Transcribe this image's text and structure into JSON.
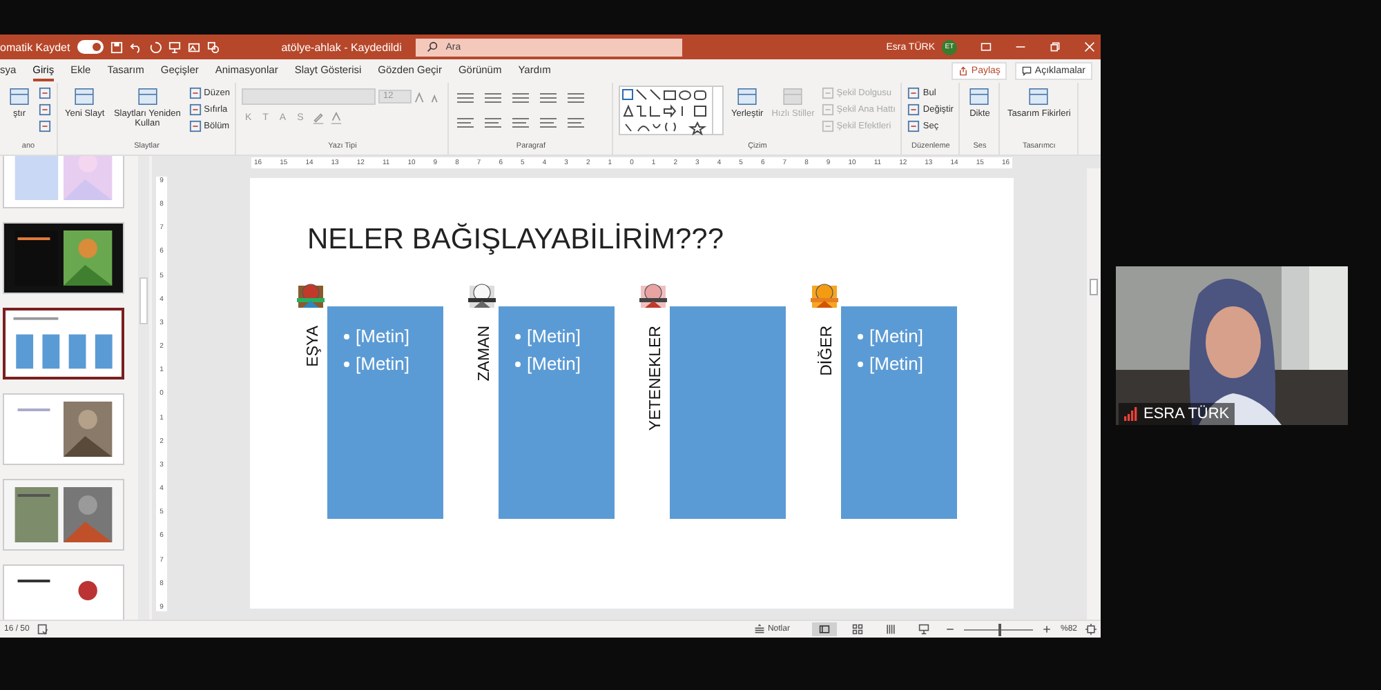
{
  "title_bar": {
    "autosave_label": "omatik Kaydet",
    "autosave_on": true,
    "doc_title": "atölye-ahlak  -  Kaydedildi",
    "search_placeholder": "Ara",
    "user_name": "Esra TÜRK",
    "user_initials": "ET"
  },
  "tabs": [
    {
      "label": "sya",
      "selected": false
    },
    {
      "label": "Giriş",
      "selected": true
    },
    {
      "label": "Ekle",
      "selected": false
    },
    {
      "label": "Tasarım",
      "selected": false
    },
    {
      "label": "Geçişler",
      "selected": false
    },
    {
      "label": "Animasyonlar",
      "selected": false
    },
    {
      "label": "Slayt Gösterisi",
      "selected": false
    },
    {
      "label": "Gözden Geçir",
      "selected": false
    },
    {
      "label": "Görünüm",
      "selected": false
    },
    {
      "label": "Yardım",
      "selected": false
    }
  ],
  "share_button": "Paylaş",
  "comments_button": "Açıklamalar",
  "ribbon": [
    {
      "label": "ano",
      "columns": [
        [
          {
            "kind": "large",
            "label": "ştır",
            "disabled": false
          }
        ],
        [
          {
            "kind": "small",
            "disabled": false
          },
          {
            "kind": "small",
            "disabled": false
          },
          {
            "kind": "small",
            "disabled": false
          }
        ]
      ]
    },
    {
      "label": "Slaytlar",
      "columns": [
        [
          {
            "kind": "large",
            "label": "Yeni Slayt",
            "disabled": false
          }
        ],
        [
          {
            "kind": "large",
            "label": "Slaytları Yeniden Kullan",
            "disabled": false
          }
        ],
        [
          {
            "kind": "small",
            "label": "Düzen",
            "disabled": false
          },
          {
            "kind": "small",
            "label": "Sıfırla",
            "disabled": false
          },
          {
            "kind": "small",
            "label": "Bölüm",
            "disabled": false
          }
        ]
      ]
    },
    {
      "label": "Yazı Tipi",
      "columns": [
        [
          {
            "kind": "fields",
            "value": "12",
            "disabled": true
          },
          {
            "kind": "glyphs",
            "glyphs": [
              "K",
              "T",
              "A",
              "S"
            ],
            "disabled": true
          }
        ]
      ]
    },
    {
      "label": "Paragraf",
      "columns": [
        [
          {
            "kind": "paragraph"
          }
        ]
      ]
    },
    {
      "label": "Çizim",
      "columns": [
        [
          {
            "kind": "shapes"
          }
        ],
        [
          {
            "kind": "large",
            "label": "Yerleştir",
            "disabled": false
          }
        ],
        [
          {
            "kind": "large",
            "label": "Hızlı Stiller",
            "disabled": true
          }
        ],
        [
          {
            "kind": "small",
            "label": "Şekil Dolgusu",
            "disabled": true
          },
          {
            "kind": "small",
            "label": "Şekil Ana Hattı",
            "disabled": true
          },
          {
            "kind": "small",
            "label": "Şekil Efektleri",
            "disabled": true
          }
        ]
      ]
    },
    {
      "label": "Düzenleme",
      "columns": [
        [
          {
            "kind": "small",
            "label": "Bul",
            "disabled": false
          },
          {
            "kind": "small",
            "label": "Değiştir",
            "disabled": false
          },
          {
            "kind": "small",
            "label": "Seç",
            "disabled": false
          }
        ]
      ]
    },
    {
      "label": "Ses",
      "columns": [
        [
          {
            "kind": "large",
            "label": "Dikte",
            "disabled": false
          }
        ]
      ]
    },
    {
      "label": "Tasarımcı",
      "columns": [
        [
          {
            "kind": "large",
            "label": "Tasarım Fikirleri",
            "disabled": false
          }
        ]
      ]
    }
  ],
  "thumbnails": [
    {
      "kind": "picture",
      "selected": false
    },
    {
      "kind": "picture",
      "selected": false
    },
    {
      "kind": "current",
      "selected": true
    },
    {
      "kind": "picture",
      "selected": false
    },
    {
      "kind": "picture",
      "selected": false
    },
    {
      "kind": "picture",
      "selected": false
    }
  ],
  "h_ruler": [
    "16",
    "15",
    "14",
    "13",
    "12",
    "11",
    "10",
    "9",
    "8",
    "7",
    "6",
    "5",
    "4",
    "3",
    "2",
    "1",
    "0",
    "1",
    "2",
    "3",
    "4",
    "5",
    "6",
    "7",
    "8",
    "9",
    "10",
    "11",
    "12",
    "13",
    "14",
    "15",
    "16"
  ],
  "v_ruler": [
    "9",
    "8",
    "7",
    "6",
    "5",
    "4",
    "3",
    "2",
    "1",
    "0",
    "1",
    "2",
    "3",
    "4",
    "5",
    "6",
    "7",
    "8",
    "9"
  ],
  "slide": {
    "title": "NELER BAĞIŞLAYABİLİRİM???",
    "columns": [
      {
        "label": "EŞYA",
        "bullets": [
          "[Metin]",
          "[Metin]"
        ]
      },
      {
        "label": "ZAMAN",
        "bullets": [
          "[Metin]",
          "[Metin]"
        ]
      },
      {
        "label": "YETENEKLER"
      },
      {
        "label": "DİĞER",
        "bullets": [
          "[Metin]",
          "[Metin]"
        ]
      }
    ]
  },
  "status_bar": {
    "slide_counter": "16 / 50",
    "notes_button": "Notlar",
    "zoom": {
      "level": 0.5
    },
    "zoom_label": "%82"
  },
  "video": {
    "name": "ESRA TÜRK"
  }
}
